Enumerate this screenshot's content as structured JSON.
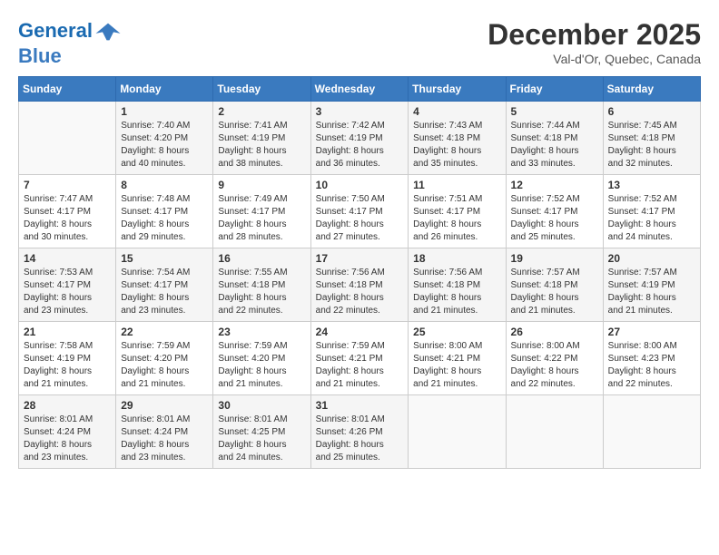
{
  "header": {
    "logo_line1": "General",
    "logo_line2": "Blue",
    "month": "December 2025",
    "location": "Val-d'Or, Quebec, Canada"
  },
  "days_of_week": [
    "Sunday",
    "Monday",
    "Tuesday",
    "Wednesday",
    "Thursday",
    "Friday",
    "Saturday"
  ],
  "weeks": [
    [
      {
        "day": "",
        "info": ""
      },
      {
        "day": "1",
        "info": "Sunrise: 7:40 AM\nSunset: 4:20 PM\nDaylight: 8 hours\nand 40 minutes."
      },
      {
        "day": "2",
        "info": "Sunrise: 7:41 AM\nSunset: 4:19 PM\nDaylight: 8 hours\nand 38 minutes."
      },
      {
        "day": "3",
        "info": "Sunrise: 7:42 AM\nSunset: 4:19 PM\nDaylight: 8 hours\nand 36 minutes."
      },
      {
        "day": "4",
        "info": "Sunrise: 7:43 AM\nSunset: 4:18 PM\nDaylight: 8 hours\nand 35 minutes."
      },
      {
        "day": "5",
        "info": "Sunrise: 7:44 AM\nSunset: 4:18 PM\nDaylight: 8 hours\nand 33 minutes."
      },
      {
        "day": "6",
        "info": "Sunrise: 7:45 AM\nSunset: 4:18 PM\nDaylight: 8 hours\nand 32 minutes."
      }
    ],
    [
      {
        "day": "7",
        "info": "Sunrise: 7:47 AM\nSunset: 4:17 PM\nDaylight: 8 hours\nand 30 minutes."
      },
      {
        "day": "8",
        "info": "Sunrise: 7:48 AM\nSunset: 4:17 PM\nDaylight: 8 hours\nand 29 minutes."
      },
      {
        "day": "9",
        "info": "Sunrise: 7:49 AM\nSunset: 4:17 PM\nDaylight: 8 hours\nand 28 minutes."
      },
      {
        "day": "10",
        "info": "Sunrise: 7:50 AM\nSunset: 4:17 PM\nDaylight: 8 hours\nand 27 minutes."
      },
      {
        "day": "11",
        "info": "Sunrise: 7:51 AM\nSunset: 4:17 PM\nDaylight: 8 hours\nand 26 minutes."
      },
      {
        "day": "12",
        "info": "Sunrise: 7:52 AM\nSunset: 4:17 PM\nDaylight: 8 hours\nand 25 minutes."
      },
      {
        "day": "13",
        "info": "Sunrise: 7:52 AM\nSunset: 4:17 PM\nDaylight: 8 hours\nand 24 minutes."
      }
    ],
    [
      {
        "day": "14",
        "info": "Sunrise: 7:53 AM\nSunset: 4:17 PM\nDaylight: 8 hours\nand 23 minutes."
      },
      {
        "day": "15",
        "info": "Sunrise: 7:54 AM\nSunset: 4:17 PM\nDaylight: 8 hours\nand 23 minutes."
      },
      {
        "day": "16",
        "info": "Sunrise: 7:55 AM\nSunset: 4:18 PM\nDaylight: 8 hours\nand 22 minutes."
      },
      {
        "day": "17",
        "info": "Sunrise: 7:56 AM\nSunset: 4:18 PM\nDaylight: 8 hours\nand 22 minutes."
      },
      {
        "day": "18",
        "info": "Sunrise: 7:56 AM\nSunset: 4:18 PM\nDaylight: 8 hours\nand 21 minutes."
      },
      {
        "day": "19",
        "info": "Sunrise: 7:57 AM\nSunset: 4:18 PM\nDaylight: 8 hours\nand 21 minutes."
      },
      {
        "day": "20",
        "info": "Sunrise: 7:57 AM\nSunset: 4:19 PM\nDaylight: 8 hours\nand 21 minutes."
      }
    ],
    [
      {
        "day": "21",
        "info": "Sunrise: 7:58 AM\nSunset: 4:19 PM\nDaylight: 8 hours\nand 21 minutes."
      },
      {
        "day": "22",
        "info": "Sunrise: 7:59 AM\nSunset: 4:20 PM\nDaylight: 8 hours\nand 21 minutes."
      },
      {
        "day": "23",
        "info": "Sunrise: 7:59 AM\nSunset: 4:20 PM\nDaylight: 8 hours\nand 21 minutes."
      },
      {
        "day": "24",
        "info": "Sunrise: 7:59 AM\nSunset: 4:21 PM\nDaylight: 8 hours\nand 21 minutes."
      },
      {
        "day": "25",
        "info": "Sunrise: 8:00 AM\nSunset: 4:21 PM\nDaylight: 8 hours\nand 21 minutes."
      },
      {
        "day": "26",
        "info": "Sunrise: 8:00 AM\nSunset: 4:22 PM\nDaylight: 8 hours\nand 22 minutes."
      },
      {
        "day": "27",
        "info": "Sunrise: 8:00 AM\nSunset: 4:23 PM\nDaylight: 8 hours\nand 22 minutes."
      }
    ],
    [
      {
        "day": "28",
        "info": "Sunrise: 8:01 AM\nSunset: 4:24 PM\nDaylight: 8 hours\nand 23 minutes."
      },
      {
        "day": "29",
        "info": "Sunrise: 8:01 AM\nSunset: 4:24 PM\nDaylight: 8 hours\nand 23 minutes."
      },
      {
        "day": "30",
        "info": "Sunrise: 8:01 AM\nSunset: 4:25 PM\nDaylight: 8 hours\nand 24 minutes."
      },
      {
        "day": "31",
        "info": "Sunrise: 8:01 AM\nSunset: 4:26 PM\nDaylight: 8 hours\nand 25 minutes."
      },
      {
        "day": "",
        "info": ""
      },
      {
        "day": "",
        "info": ""
      },
      {
        "day": "",
        "info": ""
      }
    ]
  ]
}
